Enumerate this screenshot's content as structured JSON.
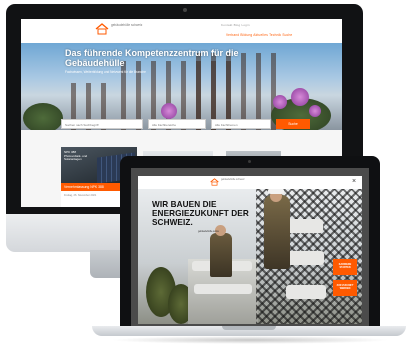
{
  "desktop_site": {
    "logo_text": "gebäudehülle schweiz",
    "top_nav": "Kontakt  Blog  Login",
    "main_nav": "Verband  Bildung  Aktuelles  Technik  Suche",
    "hero_title": "Das führende Kompetenzzentrum für die Gebäudehülle",
    "hero_subtitle": "Fachwissen, Weiterbildung und Netzwerk für die Branche",
    "search": {
      "keyword_placeholder": "Suchen nach Suchbegriff",
      "category_select": "Alle Fachbereiche",
      "topic_select": "Alle Fachthemen",
      "button_label": "Suche"
    },
    "card1": {
      "tag": "NPK 388 Photovoltaik- und Solaranlagen",
      "bar_label": "Vernehmlassung NPK 388",
      "meta": "Freitag, 26. November 2021"
    }
  },
  "laptop_site": {
    "logo_text": "gebäudehülle schweiz",
    "close_icon": "close-icon",
    "headline": "WIR BAUEN DIE ENERGIEZUKUNFT DER SCHWEIZ.",
    "tagline": "gebäudehülle.swiss",
    "badge1": "KARRIERE STARTEN",
    "badge2": "ZUR ZUKUNFT WERDEN"
  },
  "colors": {
    "accent": "#ff5a00"
  }
}
